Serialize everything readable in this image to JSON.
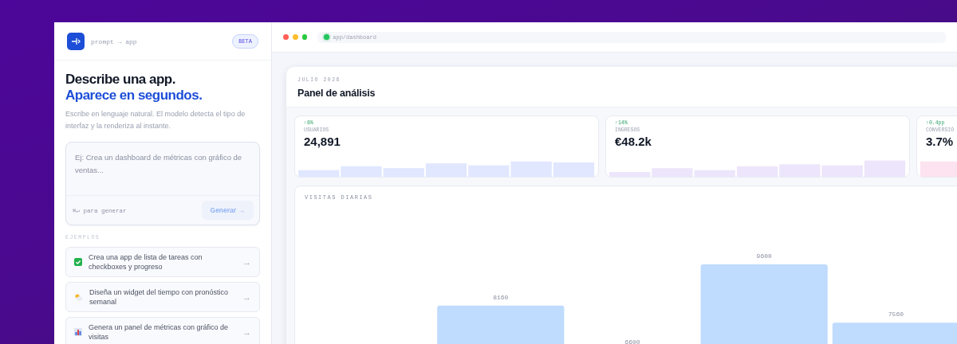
{
  "sidebar": {
    "brand": "prompt → app",
    "badge": "BETA",
    "heading": "Describe una app.",
    "heading_accent": "Aparece en segundos.",
    "subtitle": "Escribe en lenguaje natural. El modelo detecta el tipo de interfaz y la renderiza al instante.",
    "prompt": {
      "placeholder": "Ej: Crea un dashboard de métricas con gráfico de ventas...",
      "hint": "⌘↵ para generar",
      "button": "Generar →",
      "disabled": true
    },
    "examples_label": "EJEMPLOS",
    "examples": [
      {
        "kind": "checklist",
        "text": "Crea una app de lista de tareas con checkboxes y progreso",
        "arrow": "→"
      },
      {
        "kind": "weather",
        "text": "Diseña un widget del tiempo con pronóstico semanal",
        "arrow": "→"
      },
      {
        "kind": "chart",
        "text": "Genera un panel de métricas con gráfico de visitas",
        "arrow": "→"
      }
    ]
  },
  "browser": {
    "url": "app/dashboard"
  },
  "dashboard": {
    "eyebrow": "JULIO 2026",
    "title": "Panel de análisis",
    "stats": [
      {
        "label": "USUARIOS",
        "delta": "↑8%",
        "value": "24,891",
        "color": "#e0e7ff"
      },
      {
        "label": "INGRESOS",
        "delta": "↑14%",
        "value": "€48.2k",
        "color": "#ede5fb"
      },
      {
        "label": "CONVERSIÓ",
        "delta": "↑0.4pp",
        "value": "3.7%",
        "color": "#fde2ef"
      }
    ],
    "chart": {
      "title": "VISITAS DIARIAS",
      "bars": [
        {
          "label": "8160"
        },
        {
          "label": "6600"
        },
        {
          "label": "9600"
        },
        {
          "label": "7560"
        }
      ]
    }
  }
}
